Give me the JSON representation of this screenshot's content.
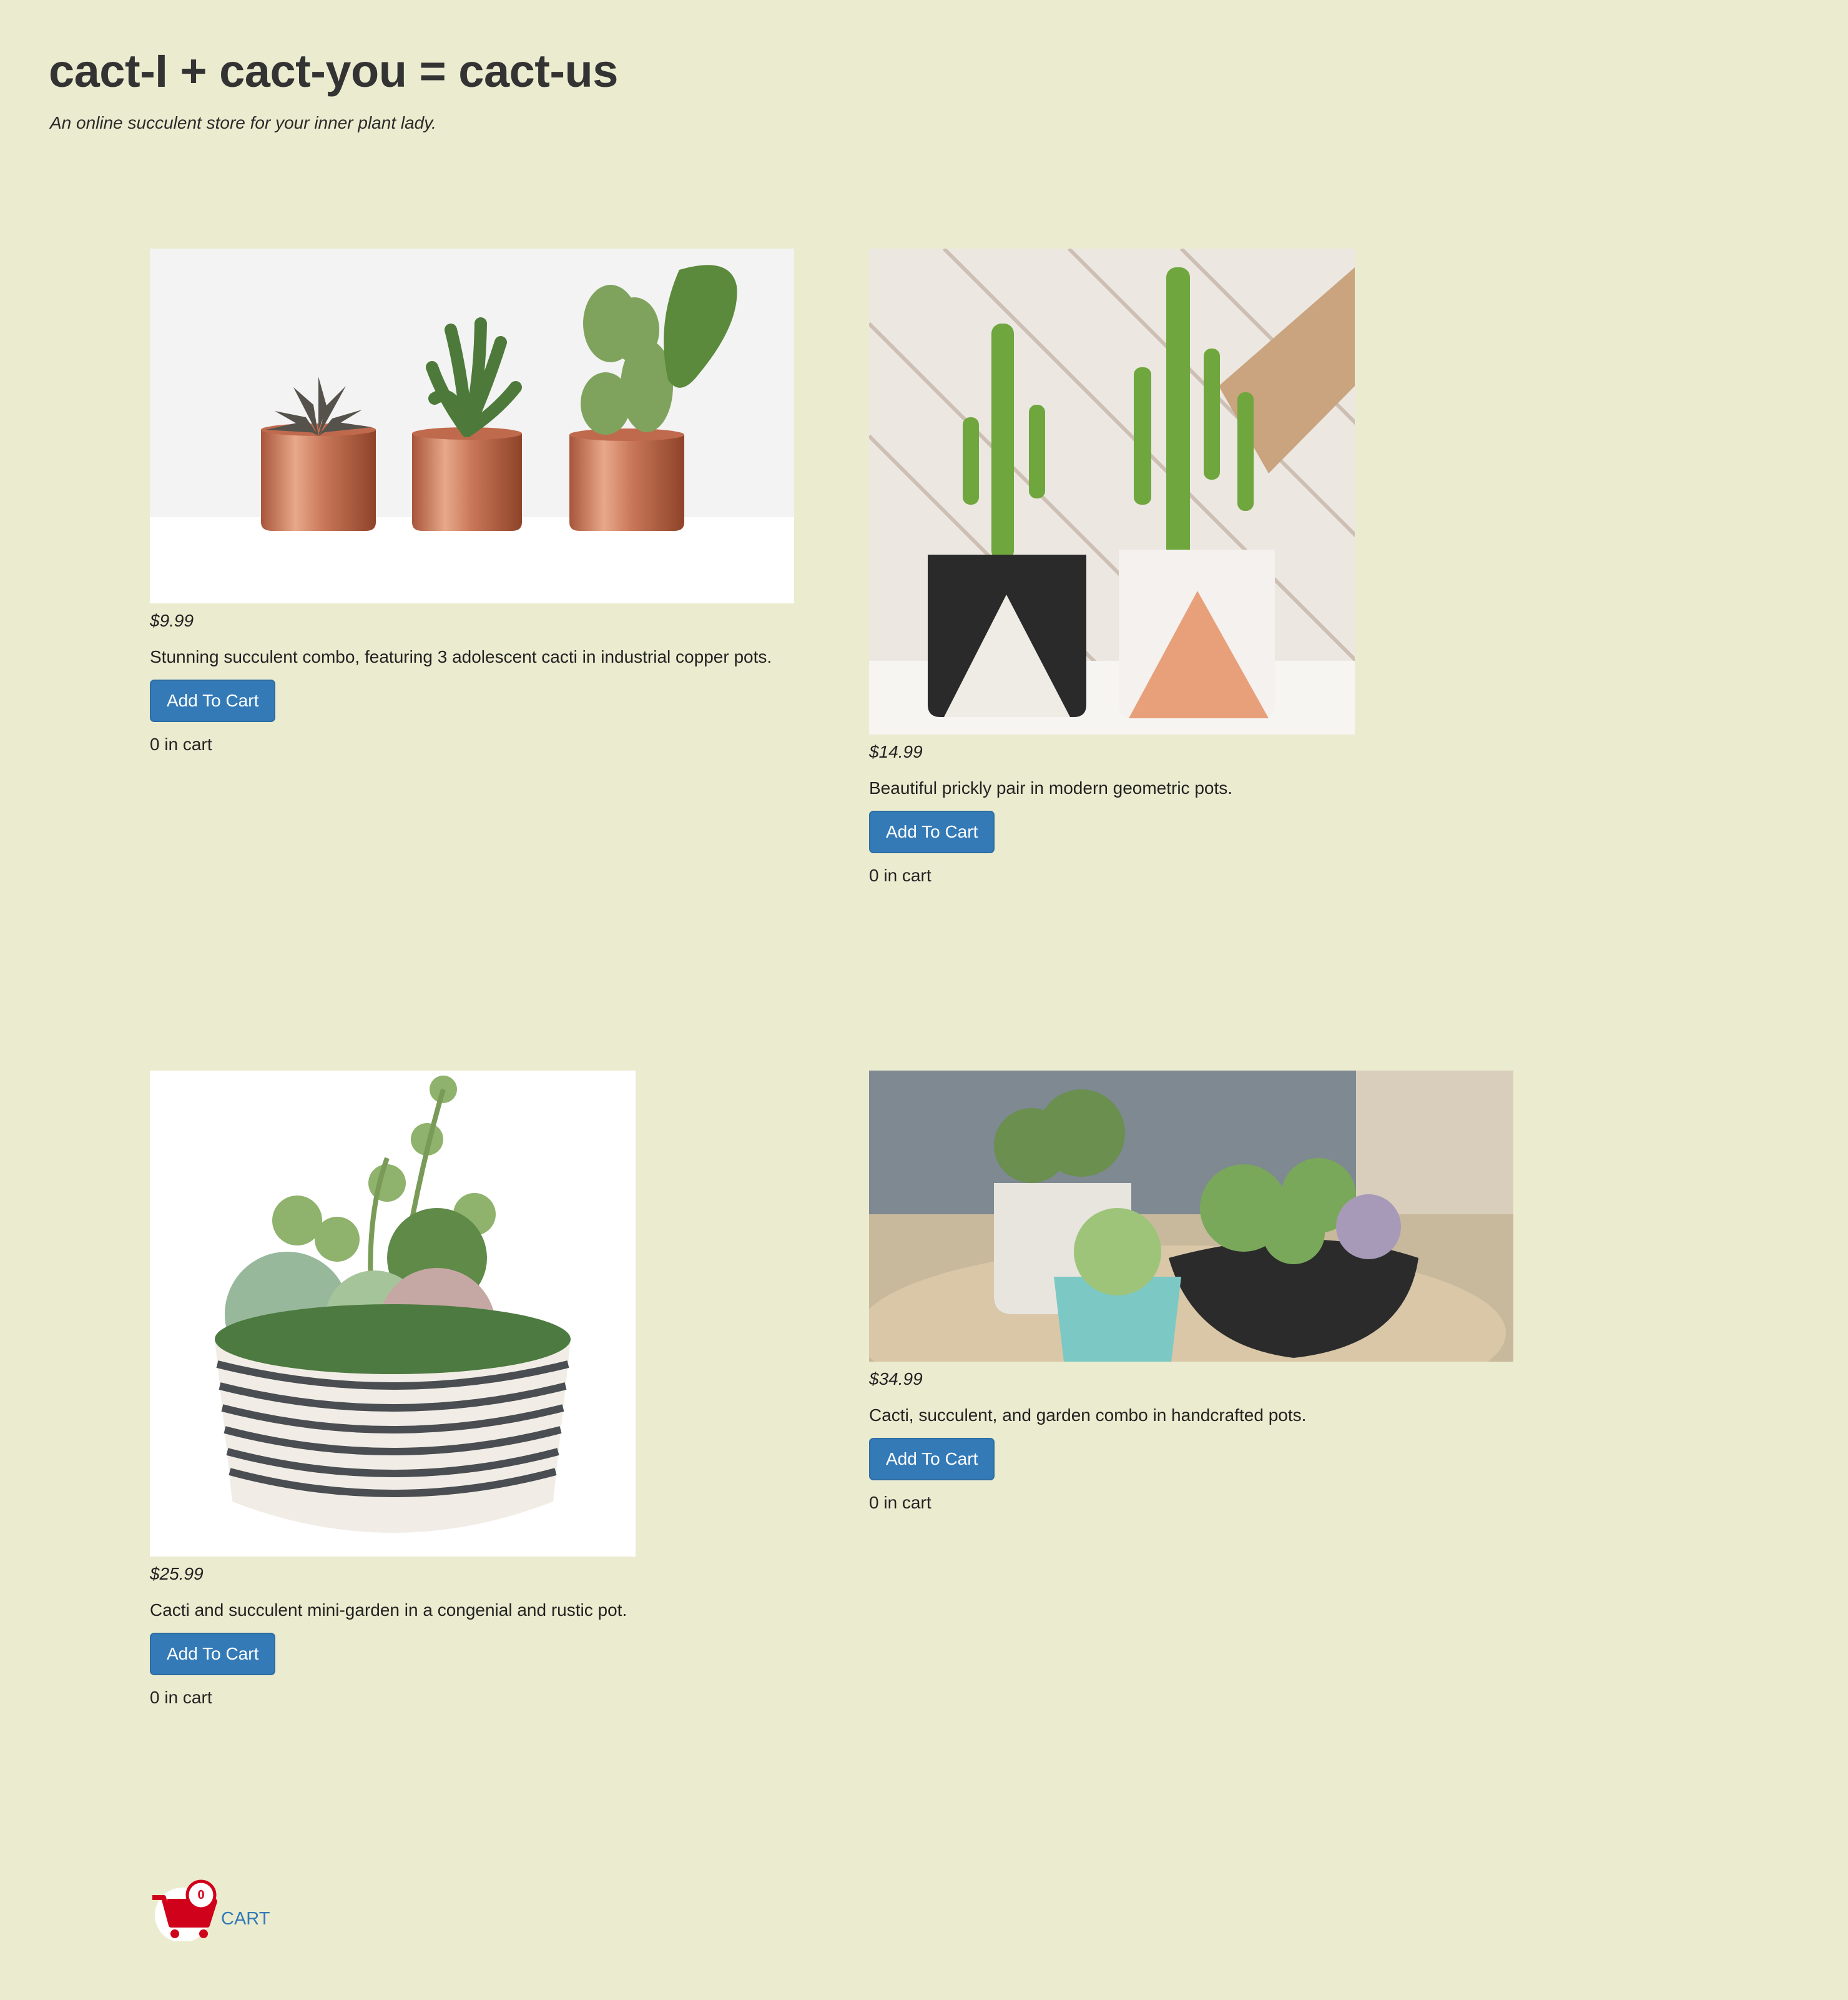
{
  "header": {
    "title": "cact-I + cact-you = cact-us",
    "tagline": "An online succulent store for your inner plant lady."
  },
  "products": [
    {
      "price": "$9.99",
      "description": "Stunning succulent combo, featuring 3 adolescent cacti in industrial copper pots.",
      "button_label": "Add To Cart",
      "cart_status": "0 in cart"
    },
    {
      "price": "$14.99",
      "description": "Beautiful prickly pair in modern geometric pots.",
      "button_label": "Add To Cart",
      "cart_status": "0 in cart"
    },
    {
      "price": "$25.99",
      "description": "Cacti and succulent mini-garden in a congenial and rustic pot.",
      "button_label": "Add To Cart",
      "cart_status": "0 in cart"
    },
    {
      "price": "$34.99",
      "description": "Cacti, succulent, and garden combo in handcrafted pots.",
      "button_label": "Add To Cart",
      "cart_status": "0 in cart"
    }
  ],
  "cart": {
    "label": "CART",
    "count": "0",
    "icon": "shopping-cart-icon"
  },
  "colors": {
    "background": "#ebeccf",
    "button": "#337ab7",
    "cart_icon": "#d0021b",
    "link": "#337ab7"
  }
}
